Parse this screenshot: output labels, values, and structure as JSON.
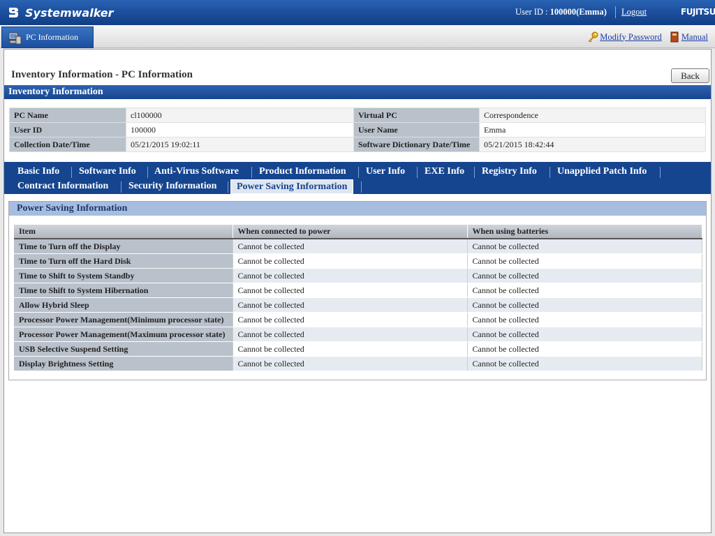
{
  "header": {
    "logo": "Systemwalker",
    "user_label": "User ID : ",
    "user_value": "100000(Emma)",
    "logout": "Logout",
    "brand": "FUJITSU"
  },
  "nav": {
    "tab": "PC Information",
    "modify_password": "Modify Password",
    "manual": "Manual"
  },
  "page": {
    "title": "Inventory Information - PC Information",
    "back": "Back",
    "section": "Inventory Information"
  },
  "inventory": {
    "rows": [
      {
        "k1": "PC Name",
        "v1": "cl100000",
        "k2": "Virtual PC",
        "v2": "Correspondence"
      },
      {
        "k1": "User ID",
        "v1": "100000",
        "k2": "User Name",
        "v2": "Emma"
      },
      {
        "k1": "Collection Date/Time",
        "v1": "05/21/2015 19:02:11",
        "k2": "Software Dictionary Date/Time",
        "v2": "05/21/2015 18:42:44"
      }
    ]
  },
  "tabs": {
    "row1": [
      "Basic Info",
      "Software Info",
      "Anti-Virus Software",
      "Product Information",
      "User Info",
      "EXE Info",
      "Registry Info",
      "Unapplied Patch Info"
    ],
    "row2": [
      "Contract Information",
      "Security Information",
      "Power Saving Information"
    ],
    "active": "Power Saving Information"
  },
  "power": {
    "title": "Power Saving Information",
    "columns": [
      "Item",
      "When connected to power",
      "When using batteries"
    ],
    "rows": [
      [
        "Time to Turn off the Display",
        "Cannot be collected",
        "Cannot be collected"
      ],
      [
        "Time to Turn off the Hard Disk",
        "Cannot be collected",
        "Cannot be collected"
      ],
      [
        "Time to Shift to System Standby",
        "Cannot be collected",
        "Cannot be collected"
      ],
      [
        "Time to Shift to System Hibernation",
        "Cannot be collected",
        "Cannot be collected"
      ],
      [
        "Allow Hybrid Sleep",
        "Cannot be collected",
        "Cannot be collected"
      ],
      [
        "Processor Power Management(Minimum processor state)",
        "Cannot be collected",
        "Cannot be collected"
      ],
      [
        "Processor Power Management(Maximum processor state)",
        "Cannot be collected",
        "Cannot be collected"
      ],
      [
        "USB Selective Suspend Setting",
        "Cannot be collected",
        "Cannot be collected"
      ],
      [
        "Display Brightness Setting",
        "Cannot be collected",
        "Cannot be collected"
      ]
    ]
  },
  "icons": {
    "logo": "systemwalker-logo-icon",
    "pc": "pc-icon",
    "key": "key-icon",
    "book": "book-icon"
  }
}
